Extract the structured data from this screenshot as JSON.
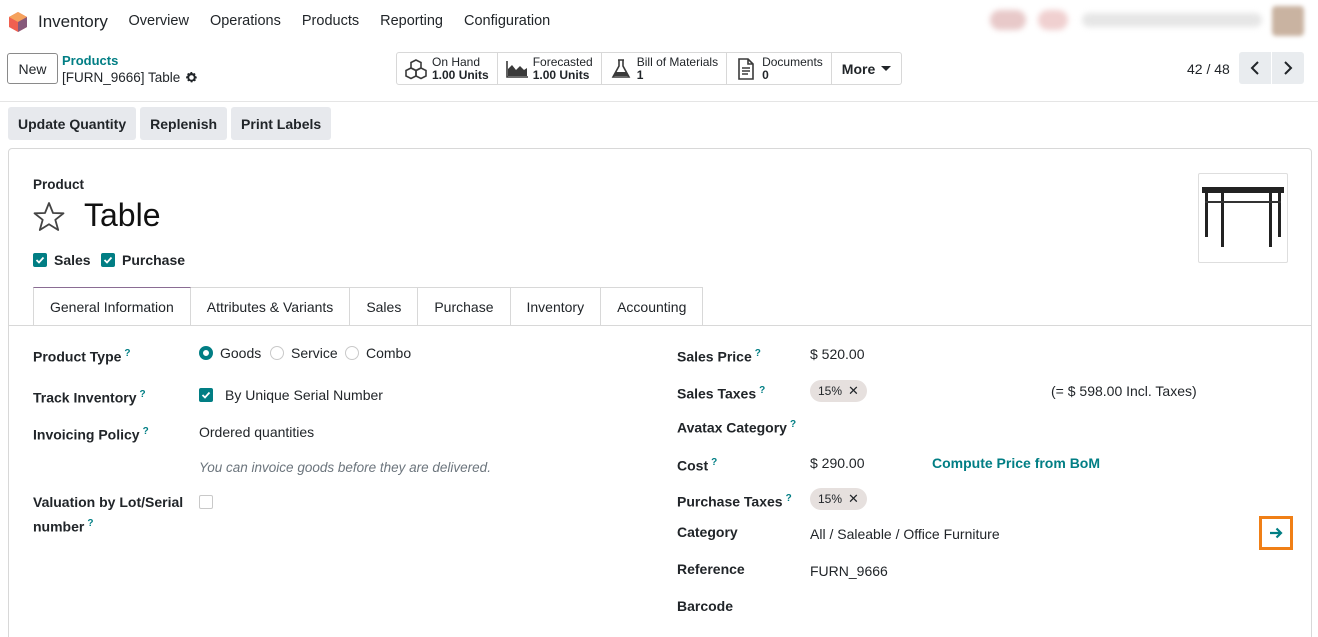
{
  "navbar": {
    "app_name": "Inventory",
    "menu": [
      "Overview",
      "Operations",
      "Products",
      "Reporting",
      "Configuration"
    ]
  },
  "control": {
    "new_label": "New",
    "breadcrumb_parent": "Products",
    "breadcrumb_current": "[FURN_9666] Table",
    "smart_buttons": [
      {
        "label": "On Hand",
        "value": "1.00 Units",
        "icon": "cubes-icon"
      },
      {
        "label": "Forecasted",
        "value": "1.00 Units",
        "icon": "area-chart-icon"
      },
      {
        "label": "Bill of Materials",
        "value": "1",
        "icon": "flask-icon"
      },
      {
        "label": "Documents",
        "value": "0",
        "icon": "file-icon"
      }
    ],
    "more_label": "More",
    "pager": "42 / 48"
  },
  "actions": [
    "Update Quantity",
    "Replenish",
    "Print Labels"
  ],
  "form": {
    "product_label": "Product",
    "title": "Table",
    "sales_label": "Sales",
    "purchase_label": "Purchase",
    "tabs": [
      "General Information",
      "Attributes & Variants",
      "Sales",
      "Purchase",
      "Inventory",
      "Accounting"
    ],
    "left": {
      "product_type_label": "Product Type",
      "product_type_options": [
        "Goods",
        "Service",
        "Combo"
      ],
      "track_inventory_label": "Track Inventory",
      "track_inventory_value": "By Unique Serial Number",
      "invoicing_policy_label": "Invoicing Policy",
      "invoicing_policy_value": "Ordered quantities",
      "invoicing_help": "You can invoice goods before they are delivered.",
      "valuation_label_1": "Valuation by Lot/Serial",
      "valuation_label_2": "number"
    },
    "right": {
      "sales_price_label": "Sales Price",
      "sales_price_value": "$ 520.00",
      "sales_taxes_label": "Sales Taxes",
      "sales_taxes_badge": "15%",
      "incl_taxes": "(= $ 598.00 Incl. Taxes)",
      "avatax_label": "Avatax Category",
      "cost_label": "Cost",
      "cost_value": "$ 290.00",
      "compute_price": "Compute Price from BoM",
      "purchase_taxes_label": "Purchase Taxes",
      "purchase_taxes_badge": "15%",
      "category_label": "Category",
      "category_value": "All / Saleable / Office Furniture",
      "reference_label": "Reference",
      "reference_value": "FURN_9666",
      "barcode_label": "Barcode"
    }
  },
  "colors": {
    "accent": "#017e84",
    "highlight": "#f07f16",
    "active_tab": "#8a6c93"
  }
}
